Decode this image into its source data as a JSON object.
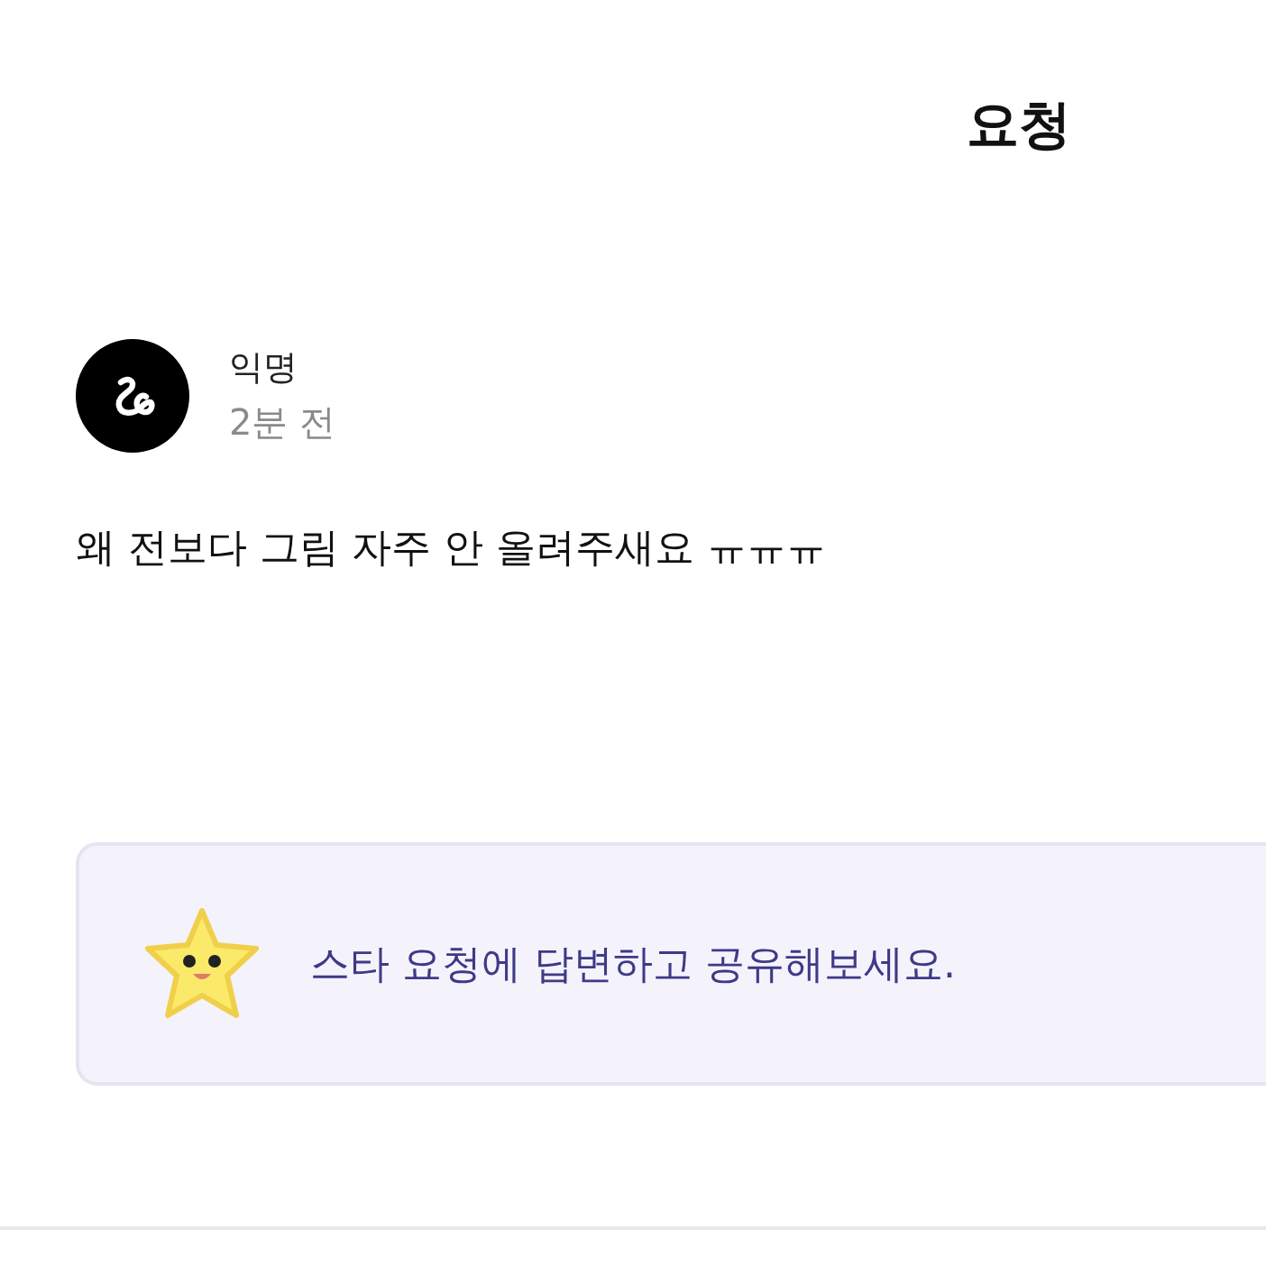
{
  "header": {
    "title": "요청"
  },
  "post": {
    "author": "익명",
    "time": "2분 전",
    "message": "왜 전보다 그림 자주 안 올려주새요 ㅠㅠㅠ"
  },
  "banner": {
    "text": "스타 요청에 답변하고 공유해보세요."
  }
}
